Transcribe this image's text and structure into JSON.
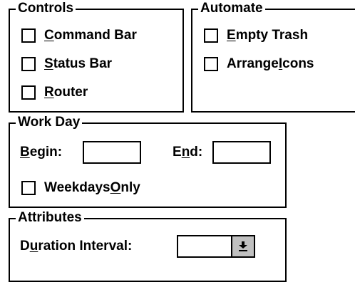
{
  "controls": {
    "title": "Controls",
    "items": [
      {
        "pre": "",
        "key": "C",
        "post": "ommand Bar",
        "checked": false
      },
      {
        "pre": "",
        "key": "S",
        "post": "tatus Bar",
        "checked": false
      },
      {
        "pre": "",
        "key": "R",
        "post": "outer",
        "checked": false
      }
    ]
  },
  "automate": {
    "title": "Automate",
    "items": [
      {
        "pre": "",
        "key": "E",
        "post": "mpty Trash",
        "checked": false
      },
      {
        "pre": "Arrange ",
        "key": "I",
        "post": "cons",
        "checked": false
      }
    ]
  },
  "work_day": {
    "title": "Work Day",
    "begin": {
      "pre": "",
      "key": "B",
      "post": "egin:",
      "value": ""
    },
    "end": {
      "pre": "E",
      "key": "n",
      "post": "d:",
      "value": ""
    },
    "weekdays": {
      "pre": "Weekdays ",
      "key": "O",
      "post": "nly",
      "checked": false
    }
  },
  "attributes": {
    "title": "Attributes",
    "duration": {
      "pre": "D",
      "key": "u",
      "post": "ration Interval:",
      "value": ""
    },
    "dropdown_icon": "arrow-down-bar-icon"
  }
}
